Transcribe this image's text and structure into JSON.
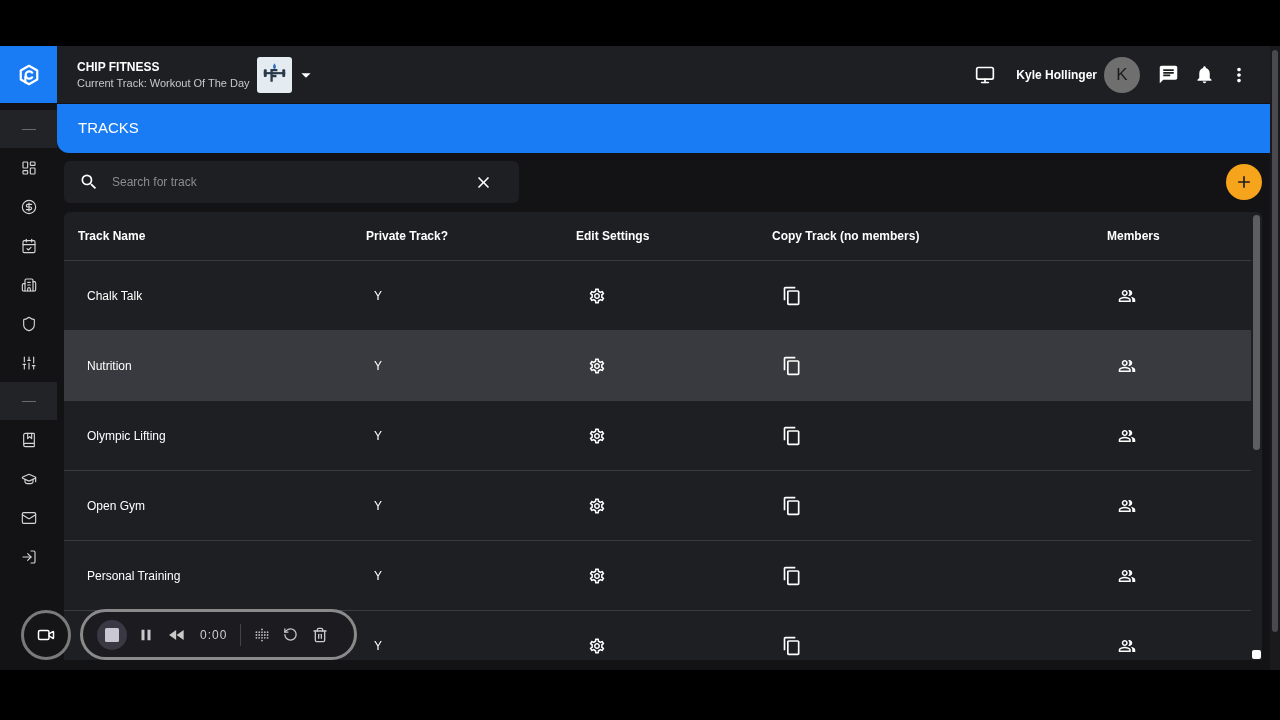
{
  "header": {
    "title": "CHIP FITNESS",
    "subtitle": "Current Track: Workout Of The Day",
    "user_name": "Kyle Hollinger",
    "avatar_initial": "K"
  },
  "page_title": "TRACKS",
  "search": {
    "placeholder": "Search for track"
  },
  "table": {
    "columns": [
      "Track Name",
      "Private Track?",
      "Edit Settings",
      "Copy Track (no members)",
      "Members"
    ],
    "rows": [
      {
        "name": "Chalk Talk",
        "private": "Y",
        "highlighted": false
      },
      {
        "name": "Nutrition",
        "private": "Y",
        "highlighted": true
      },
      {
        "name": "Olympic Lifting",
        "private": "Y",
        "highlighted": false
      },
      {
        "name": "Open Gym",
        "private": "Y",
        "highlighted": false
      },
      {
        "name": "Personal Training",
        "private": "Y",
        "highlighted": false
      },
      {
        "private": "Y",
        "highlighted": false
      }
    ]
  },
  "recorder": {
    "time": "0:00"
  }
}
